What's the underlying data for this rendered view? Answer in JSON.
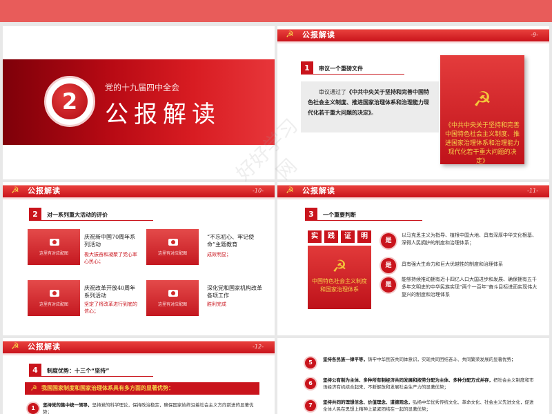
{
  "header_title": "公报解读",
  "emblem": "hammer-sickle-icon",
  "slide1": {
    "number": "2",
    "subtitle": "党的十九届四中全会",
    "title": "公报解读"
  },
  "slide2": {
    "page": "-9-",
    "section_number": "1",
    "section_label": "审议一个重磅文件",
    "body_prefix": "审议通过了",
    "body_bold": "《中共中央关于坚持和完善中国特色社会主义制度、推进国家治理体系和治理能力现代化若干重大问题的决定》",
    "body_suffix": "。",
    "card_text": "《中共中央关于坚持和完善中国特色社会主义制度、推进国家治理体系和治理能力现代化若干重大问题的决定》"
  },
  "slide3": {
    "page": "-10-",
    "section_number": "2",
    "section_label": "对一系列重大活动的评价",
    "placeholder": "这里有对应配图",
    "items": [
      {
        "title": "庆祝新中国70周年系列活动",
        "desc": "极大振奋和凝聚了党心军心民心；"
      },
      {
        "title": "“不忘初心、牢记使命”主题教育",
        "desc": "成效明显；"
      },
      {
        "title": "庆祝改革开放40周年系列活动",
        "desc": "坚定了将改革进行到底的信心；"
      },
      {
        "title": "深化党和国家机构改革各项工作",
        "desc": "胜利完成"
      }
    ]
  },
  "slide4": {
    "page": "-11-",
    "section_number": "3",
    "section_label": "一个重要判断",
    "labels": [
      "实",
      "践",
      "证",
      "明"
    ],
    "box_text": "中国特色社会主义制度和国家治理体系",
    "badge": "是",
    "rows": [
      "以马克思主义为指导、植根中国大地、具有深厚中华文化根基、深得人民拥护的制度和治理体系；",
      "具有强大生命力和巨大优越性的制度和治理体系",
      "能够持续推动拥有近十四亿人口大国进步和发展、确保拥有五千多年文明史的中华民族实现“两个一百年”奋斗目标进而实现伟大复兴的制度和治理体系"
    ]
  },
  "slide5": {
    "page": "-12-",
    "section_number": "4",
    "section_label": "制度优势：十三个“坚持”",
    "bar_text": "我国国家制度和国家治理体系具有多方面的显著优势：",
    "item_number": "1",
    "item_bold": "坚持党的集中统一领导，",
    "item_text": "坚持党的科学理论，保持政治稳定，确保国家始终沿着社会主义方向前进的显著优势；"
  },
  "slide6": {
    "items": [
      {
        "number": "5",
        "bold": "坚持各民族一律平等，",
        "text": "铸牢中华民族共同体意识，实现共同团结奋斗、共同繁荣发展的显著优势；"
      },
      {
        "number": "6",
        "bold": "坚持公有制为主体、多种所有制经济共同发展和按劳分配为主体、多种分配方式并存，",
        "text": "把社会主义制度和市场经济有机结合起来，不断解放和发展社会生产力的显著优势；"
      },
      {
        "number": "7",
        "bold": "坚持共同的理想信念、价值理念、道德观念，",
        "text": "弘扬中华优秀传统文化、革命文化、社会主义先进文化，促进全体人民在思想上精神上紧紧团结在一起的显著优势；"
      }
    ]
  },
  "watermark": "好好学习网"
}
